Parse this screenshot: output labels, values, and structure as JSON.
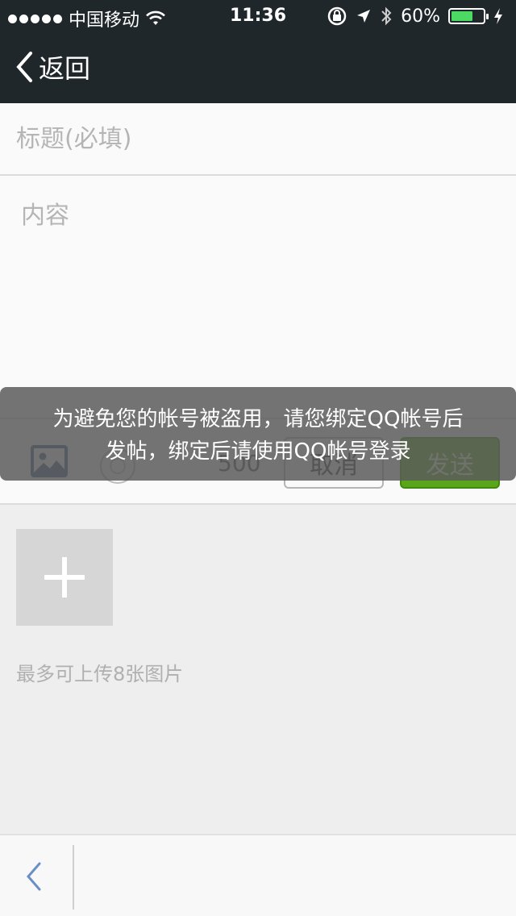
{
  "status_bar": {
    "carrier": "中国移动",
    "time": "11:36",
    "battery": "60%",
    "battery_level": 0.6
  },
  "nav": {
    "back_label": "返回"
  },
  "form": {
    "title_placeholder": "标题(必填)",
    "content_placeholder": "内容"
  },
  "toolbar": {
    "char_count": "500",
    "cancel_label": "取消",
    "send_label": "发送"
  },
  "toast": {
    "line1": "为避免您的帐号被盗用，请您绑定QQ帐号后",
    "line2": "发帖，绑定后请使用QQ帐号登录"
  },
  "attachments": {
    "hint": "最多可上传8张图片"
  },
  "colors": {
    "header_bg": "#1f272a",
    "send_green": "#5aa51a",
    "image_icon": "#3f5f8f"
  }
}
